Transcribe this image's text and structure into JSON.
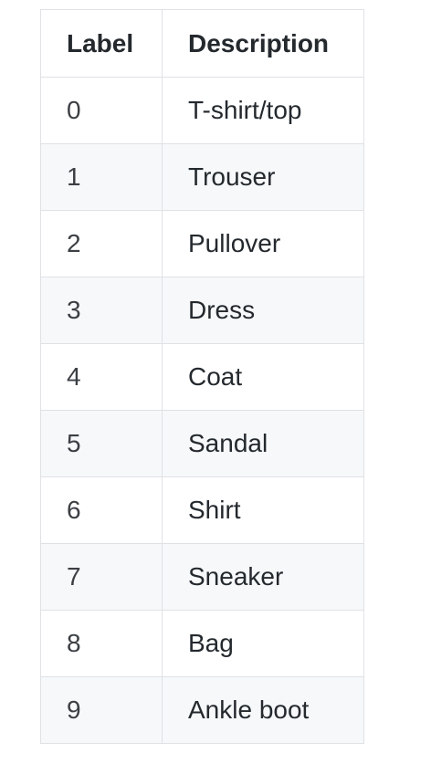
{
  "table": {
    "headers": {
      "label": "Label",
      "description": "Description"
    },
    "rows": [
      {
        "label": "0",
        "description": "T-shirt/top"
      },
      {
        "label": "1",
        "description": "Trouser"
      },
      {
        "label": "2",
        "description": "Pullover"
      },
      {
        "label": "3",
        "description": "Dress"
      },
      {
        "label": "4",
        "description": "Coat"
      },
      {
        "label": "5",
        "description": "Sandal"
      },
      {
        "label": "6",
        "description": "Shirt"
      },
      {
        "label": "7",
        "description": "Sneaker"
      },
      {
        "label": "8",
        "description": "Bag"
      },
      {
        "label": "9",
        "description": "Ankle boot"
      }
    ]
  },
  "colors": {
    "border": "#dfe2e5",
    "stripe": "#f6f8fa",
    "text": "#24292e"
  }
}
